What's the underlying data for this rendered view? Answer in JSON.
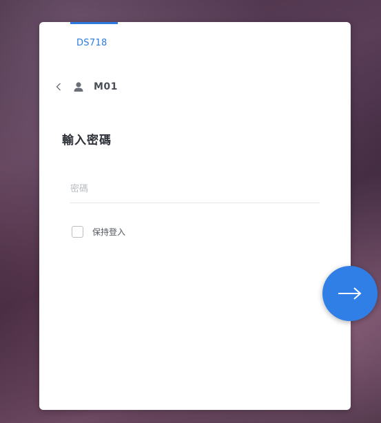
{
  "server": {
    "name": "DS718"
  },
  "user": {
    "name": "M01"
  },
  "login": {
    "heading": "輸入密碼",
    "password_placeholder": "密碼",
    "password_value": "",
    "remember_label": "保持登入",
    "remember_checked": false
  },
  "icons": {
    "back": "chevron-left-icon",
    "user": "user-icon",
    "next": "arrow-right-icon"
  },
  "colors": {
    "accent": "#2a7ae2",
    "next_button": "#2f7fe6"
  }
}
